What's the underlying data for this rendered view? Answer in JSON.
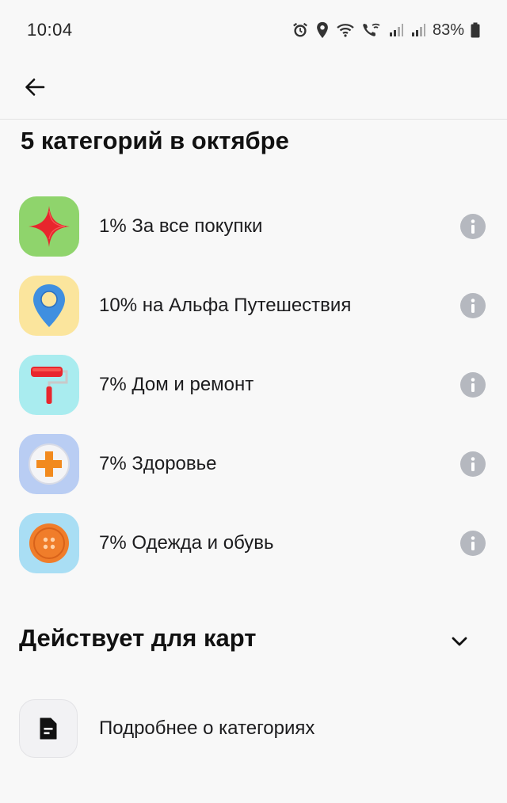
{
  "status_bar": {
    "time": "10:04",
    "battery": "83%",
    "icons": [
      "alarm-icon",
      "location-icon",
      "wifi-icon",
      "wifi-call-icon",
      "signal-icon",
      "signal-icon-2",
      "battery-icon"
    ]
  },
  "toolbar": {
    "back_icon": "arrow-left-icon"
  },
  "categories_section": {
    "title": "5 категорий в октябре",
    "items": [
      {
        "label": "1% За все покупки",
        "icon": "star-icon",
        "bg": "#8fd46c"
      },
      {
        "label": "10% на Альфа Путешествия",
        "icon": "map-pin-icon",
        "bg": "#fbe59d"
      },
      {
        "label": "7% Дом и ремонт",
        "icon": "paint-roller-icon",
        "bg": "#a9ecef"
      },
      {
        "label": "7% Здоровье",
        "icon": "medical-cross-icon",
        "bg": "#b9cdf3"
      },
      {
        "label": "7% Одежда и обувь",
        "icon": "button-icon",
        "bg": "#a9def4"
      }
    ],
    "info_icon": "info-icon"
  },
  "cards_section": {
    "title": "Действует для карт",
    "expand_icon": "chevron-down-icon"
  },
  "more_link": {
    "label": "Подробнее о категориях",
    "icon": "document-icon"
  },
  "colors": {
    "background": "#f8f8f8",
    "info_icon": "#b5b8bf",
    "text": "#1c1c1e"
  }
}
